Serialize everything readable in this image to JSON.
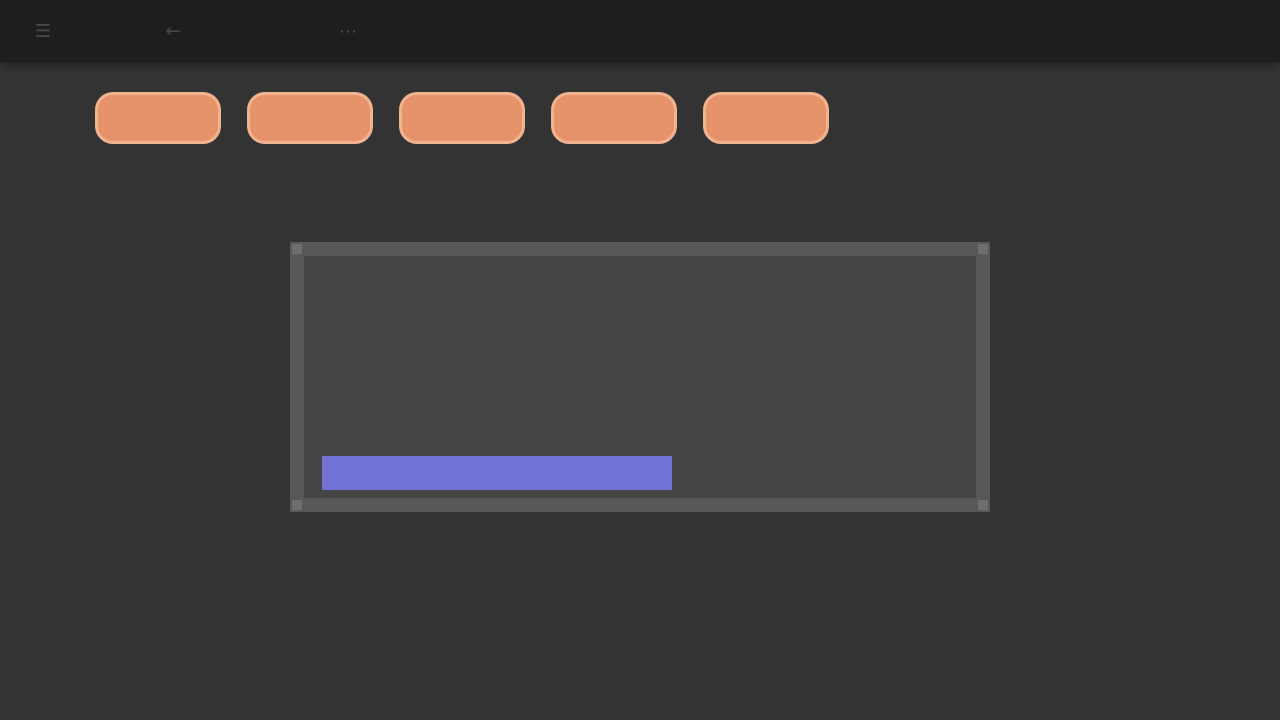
{
  "topbar": {
    "menu_icon": "menu-icon",
    "back_icon": "back-arrow-icon",
    "title": "",
    "more_icon": "more-icon"
  },
  "chips": [
    {
      "label": ""
    },
    {
      "label": ""
    },
    {
      "label": ""
    },
    {
      "label": ""
    },
    {
      "label": ""
    }
  ],
  "panel": {
    "text": "",
    "link_text": ""
  },
  "colors": {
    "background": "#333333",
    "topbar": "#1e1e1e",
    "chip": "#e6926a",
    "panel": "#454545",
    "panel_border": "#585858",
    "link": "#7373d6"
  }
}
